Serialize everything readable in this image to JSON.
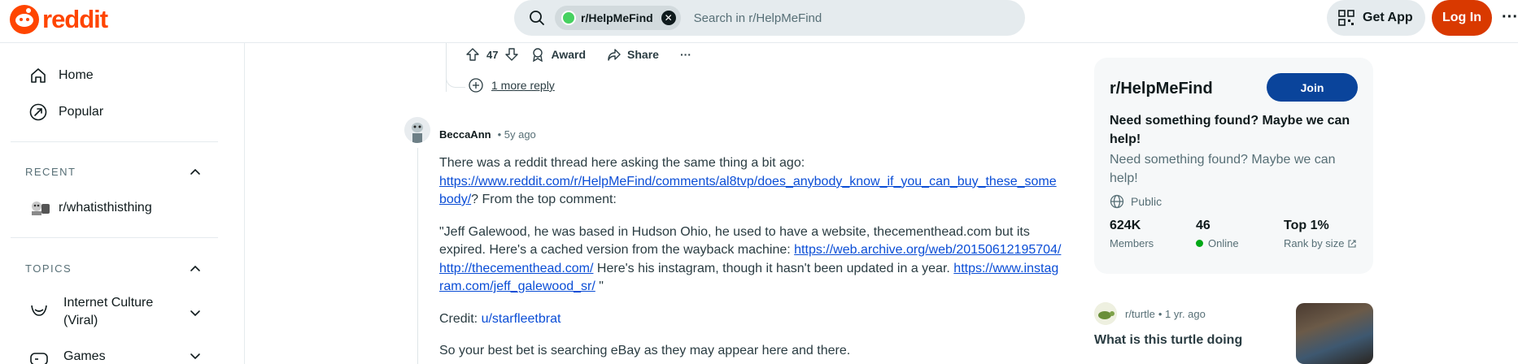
{
  "header": {
    "logo_text": "reddit",
    "search_chip": "r/HelpMeFind",
    "search_placeholder": "Search in r/HelpMeFind",
    "get_app": "Get App",
    "login": "Log In",
    "more": "···"
  },
  "sidebar": {
    "nav": [
      {
        "label": "Home",
        "icon": "home-icon"
      },
      {
        "label": "Popular",
        "icon": "popular-icon"
      }
    ],
    "recent_title": "RECENT",
    "recent_items": [
      {
        "label": "r/whatisthisthing"
      }
    ],
    "topics_title": "TOPICS",
    "topics": [
      {
        "label": "Internet Culture (Viral)",
        "icon": "smile-icon"
      },
      {
        "label": "Games",
        "icon": "gamepad-icon"
      }
    ]
  },
  "parent_actions": {
    "votes": "47",
    "award": "Award",
    "share": "Share",
    "more": "···",
    "more_reply": "1 more reply"
  },
  "comment": {
    "author": "BeccaAnn",
    "age": "• 5y ago",
    "p1_text": "There was a reddit thread here asking the same thing a bit ago:",
    "p1_link": "https://www.reddit.com/r/HelpMeFind/comments/al8tvp/does_anybody_know_if_you_can_buy_these_somebody/",
    "p1_tail": "? From the top comment:",
    "p2_text": "\"Jeff Galewood, he was based in Hudson Ohio, he used to have a website, thecementhead.com but its expired. Here's a cached version from the wayback machine:",
    "p2_link1": "https://web.archive.org/web/20150612195704/http://thecementhead.com/",
    "p2_mid": "Here's his instagram, though it hasn't been updated in a year.",
    "p2_link2": "https://www.instagram.com/jeff_galewood_sr/",
    "p2_tail": "\"",
    "p3_label": "Credit:",
    "p3_user": "u/starfleetbrat",
    "p4_text": "So your best bet is searching eBay as they may appear here and there."
  },
  "community": {
    "name": "r/HelpMeFind",
    "join": "Join",
    "title": "Need something found? Maybe we can help!",
    "description": "Need something found? Maybe we can help!",
    "visibility": "Public",
    "stats": [
      {
        "value": "624K",
        "label": "Members"
      },
      {
        "value": "46",
        "label": "Online"
      },
      {
        "value": "Top 1%",
        "label": "Rank by size"
      }
    ]
  },
  "related_post": {
    "subreddit": "r/turtle",
    "age": "• 1 yr. ago",
    "title": "What is this turtle doing"
  },
  "colors": {
    "brand": "#ff4500",
    "login": "#d93900",
    "join": "#0a449b",
    "link": "#0a4dd6",
    "online": "#01a816"
  }
}
